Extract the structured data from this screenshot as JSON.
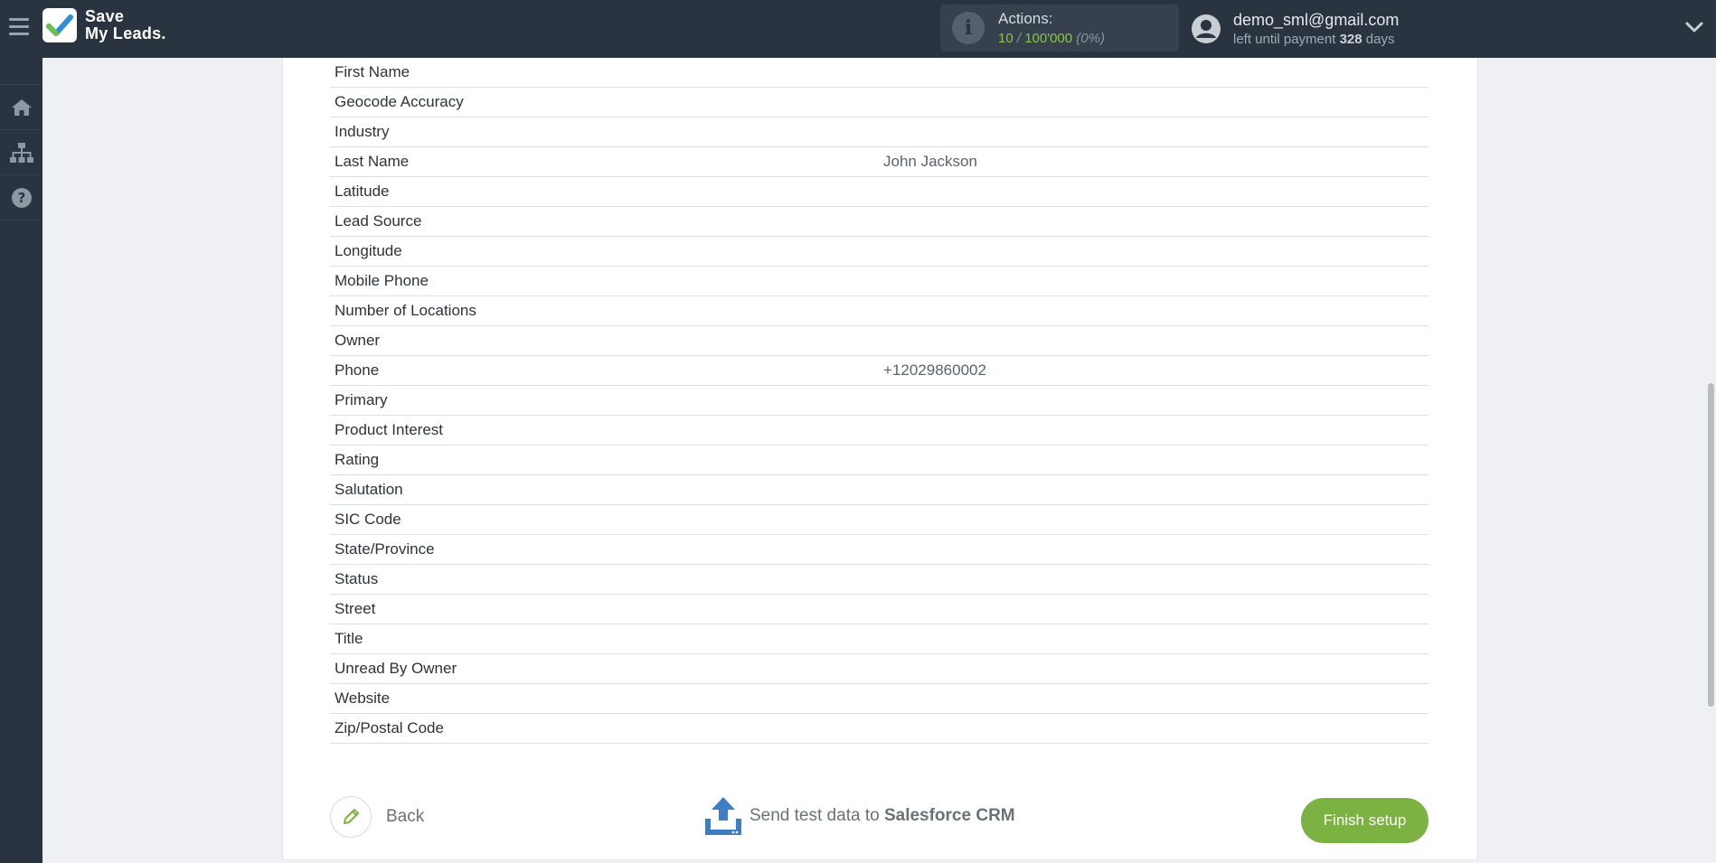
{
  "header": {
    "logo_line1": "Save",
    "logo_line2": "My Leads.",
    "actions_label": "Actions:",
    "actions_used": "10",
    "actions_sep": " / ",
    "actions_total": "100'000",
    "actions_pct": " (0%)",
    "user_email": "demo_sml@gmail.com",
    "payment_prefix": "left until payment ",
    "payment_days": "328",
    "payment_suffix": " days"
  },
  "sidebar": {
    "items": [
      {
        "icon": "home-icon"
      },
      {
        "icon": "sitemap-icon"
      },
      {
        "icon": "help-icon"
      }
    ]
  },
  "fields": [
    {
      "name": "First Name",
      "value": ""
    },
    {
      "name": "Geocode Accuracy",
      "value": ""
    },
    {
      "name": "Industry",
      "value": ""
    },
    {
      "name": "Last Name",
      "value": "John Jackson"
    },
    {
      "name": "Latitude",
      "value": ""
    },
    {
      "name": "Lead Source",
      "value": ""
    },
    {
      "name": "Longitude",
      "value": ""
    },
    {
      "name": "Mobile Phone",
      "value": ""
    },
    {
      "name": "Number of Locations",
      "value": ""
    },
    {
      "name": "Owner",
      "value": ""
    },
    {
      "name": "Phone",
      "value": "+12029860002"
    },
    {
      "name": "Primary",
      "value": ""
    },
    {
      "name": "Product Interest",
      "value": ""
    },
    {
      "name": "Rating",
      "value": ""
    },
    {
      "name": "Salutation",
      "value": ""
    },
    {
      "name": "SIC Code",
      "value": ""
    },
    {
      "name": "State/Province",
      "value": ""
    },
    {
      "name": "Status",
      "value": ""
    },
    {
      "name": "Street",
      "value": ""
    },
    {
      "name": "Title",
      "value": ""
    },
    {
      "name": "Unread By Owner",
      "value": ""
    },
    {
      "name": "Website",
      "value": ""
    },
    {
      "name": "Zip/Postal Code",
      "value": ""
    }
  ],
  "footer": {
    "back_label": "Back",
    "send_prefix": "Send test data to ",
    "send_target": "Salesforce CRM",
    "finish_label": "Finish setup"
  },
  "colors": {
    "topbar": "#2a3441",
    "accent_green": "#7bb241",
    "upload_blue": "#3f7fc1"
  }
}
